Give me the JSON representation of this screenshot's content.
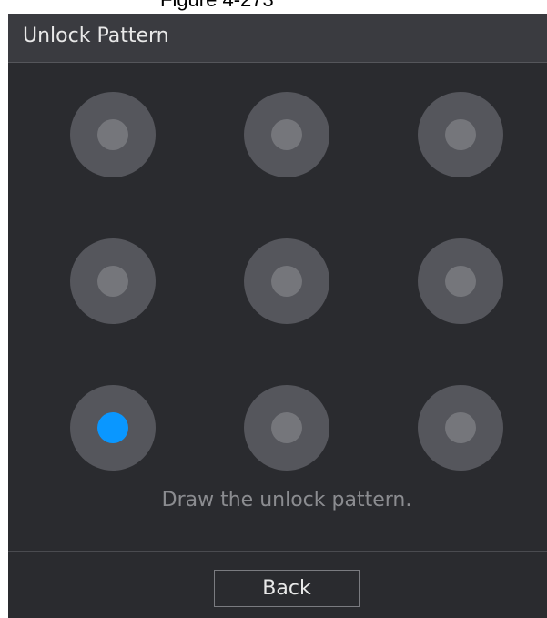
{
  "caption": "Figure 4-273",
  "dialog": {
    "title": "Unlock Pattern",
    "prompt": "Draw the unlock pattern.",
    "back_label": "Back"
  },
  "pattern_grid": {
    "rows": 3,
    "columns": 3,
    "selected_dots": [
      7
    ],
    "colors": {
      "dot_ring": "#55565c",
      "dot_core": "#75767b",
      "selected_core": "#0a97ff",
      "background": "#2a2b2f",
      "title_bar": "#3a3b40"
    }
  }
}
